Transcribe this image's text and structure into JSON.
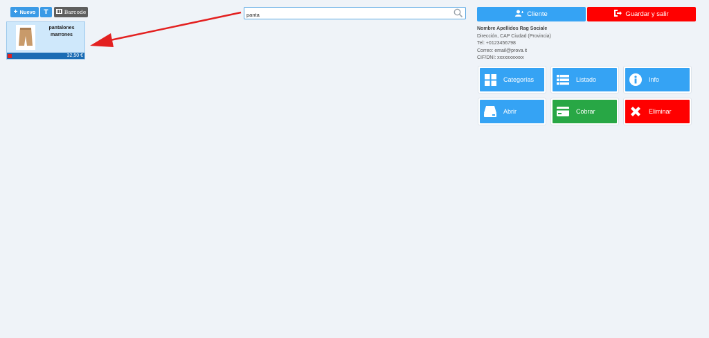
{
  "toolbar": {
    "new_label": "Nuevo",
    "text_label": "T",
    "barcode_label": "Barcode"
  },
  "product": {
    "name": "pantalones marrones",
    "price": "32,50 €"
  },
  "search": {
    "value": "panta"
  },
  "header_buttons": {
    "client_label": "Cliente",
    "save_exit_label": "Guardar y salir"
  },
  "customer": {
    "name": "Nombre Apellidos Rag Sociale",
    "address": "Dirección, CAP Ciudad (Provincia)",
    "phone": "Tel: +0123456798",
    "email": "Correo: email@prova.it",
    "tax_id": "CIF/DNI: xxxxxxxxxxx"
  },
  "tiles": {
    "categories": "Categorías",
    "list": "Listado",
    "info": "Info",
    "open": "Abrir",
    "charge": "Cobrar",
    "delete": "Eliminar"
  },
  "colors": {
    "blue": "#35a3f4",
    "green": "#28a745",
    "red": "#ff0000",
    "arrow": "#e32020"
  }
}
